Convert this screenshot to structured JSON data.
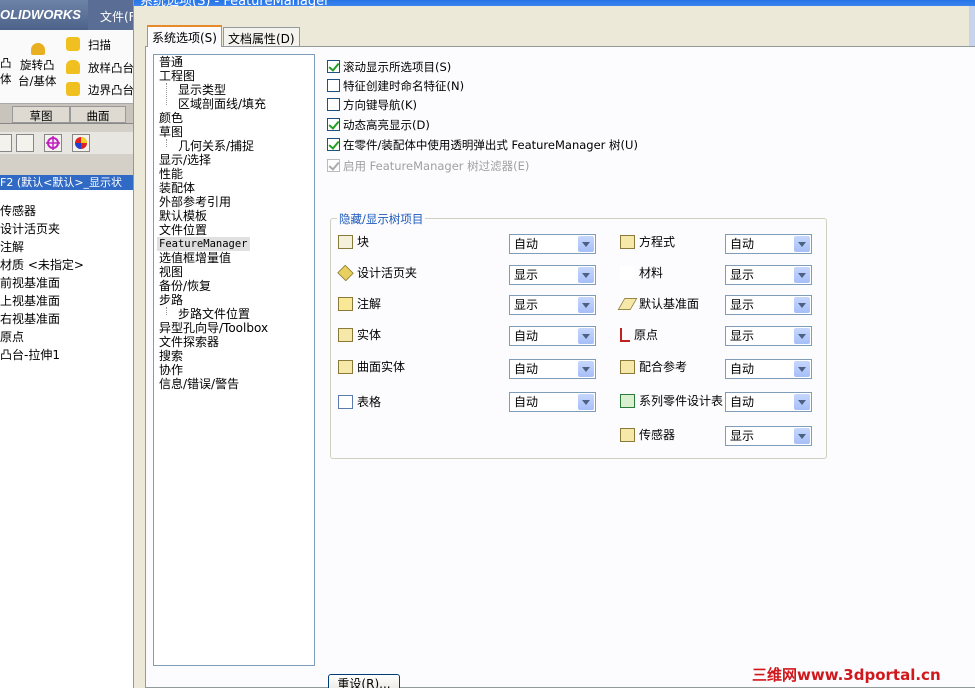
{
  "solidworks": {
    "logo": "OLIDWORKS",
    "file_menu": "文件(F",
    "ribbon": {
      "left_partial_1": "凸",
      "left_partial_2": "体",
      "revolve_1": "旋转凸",
      "revolve_2": "台/基体",
      "sweep": "扫描",
      "loft": "放样凸台",
      "boundary": "边界凸台"
    },
    "tabs": [
      "草图",
      "曲面"
    ],
    "tree_header": "F2  (默认<默认>_显示状",
    "tree_items": [
      "传感器",
      "设计活页夹",
      "注解",
      "材质 <未指定>",
      "前视基准面",
      "上视基准面",
      "右视基准面",
      "原点",
      "凸台-拉伸1"
    ]
  },
  "dialog": {
    "title": "系统选项(S) - FeatureManager",
    "tabs": [
      "系统选项(S)",
      "文档属性(D)"
    ],
    "tree": {
      "general": "普通",
      "drawings": "工程图",
      "display_type": "显示类型",
      "area_hatch": "区域剖面线/填充",
      "colors": "颜色",
      "sketch": "草图",
      "relations_snaps": "几何关系/捕捉",
      "display_selection": "显示/选择",
      "performance": "性能",
      "assemblies": "装配体",
      "external_refs": "外部参考引用",
      "default_templates": "默认模板",
      "file_locations": "文件位置",
      "feature_manager": "FeatureManager",
      "spin_box": "选值框增量值",
      "view": "视图",
      "backup": "备份/恢复",
      "routing": "步路",
      "routing_files": "步路文件位置",
      "hole_wizard": "异型孔向导/Toolbox",
      "file_explorer": "文件探索器",
      "search": "搜索",
      "collaboration": "协作",
      "messages": "信息/错误/警告"
    },
    "options": [
      {
        "label": "滚动显示所选项目(S)",
        "checked": true
      },
      {
        "label": "特征创建时命名特征(N)",
        "checked": false
      },
      {
        "label": "方向键导航(K)",
        "checked": false
      },
      {
        "label": "动态高亮显示(D)",
        "checked": true
      },
      {
        "label": "在零件/装配体中使用透明弹出式 FeatureManager 树(U)",
        "checked": true
      },
      {
        "label": "启用 FeatureManager 树过滤器(E)",
        "checked": true,
        "disabled": true
      }
    ],
    "group_title": "隐藏/显示树项目",
    "left_items": [
      {
        "label": "块",
        "value": "自动",
        "icon": "block-icon"
      },
      {
        "label": "设计活页夹",
        "value": "显示",
        "icon": "design-binder-icon"
      },
      {
        "label": "注解",
        "value": "显示",
        "icon": "annotation-icon"
      },
      {
        "label": "实体",
        "value": "自动",
        "icon": "solid-bodies-icon"
      },
      {
        "label": "曲面实体",
        "value": "自动",
        "icon": "surface-bodies-icon"
      },
      {
        "label": "表格",
        "value": "自动",
        "icon": "table-icon"
      }
    ],
    "right_items": [
      {
        "label": "方程式",
        "value": "自动",
        "icon": "equations-icon"
      },
      {
        "label": "材料",
        "value": "显示",
        "icon": "material-icon"
      },
      {
        "label": "默认基准面",
        "value": "显示",
        "icon": "default-plane-icon"
      },
      {
        "label": "原点",
        "value": "显示",
        "icon": "origin-icon"
      },
      {
        "label": "配合参考",
        "value": "自动",
        "icon": "mate-reference-icon"
      },
      {
        "label": "系列零件设计表",
        "value": "自动",
        "icon": "design-table-icon"
      },
      {
        "label": "传感器",
        "value": "显示",
        "icon": "sensor-icon"
      }
    ],
    "reset_button": "重设(R)..."
  },
  "watermark": "三维网www.3dportal.cn"
}
